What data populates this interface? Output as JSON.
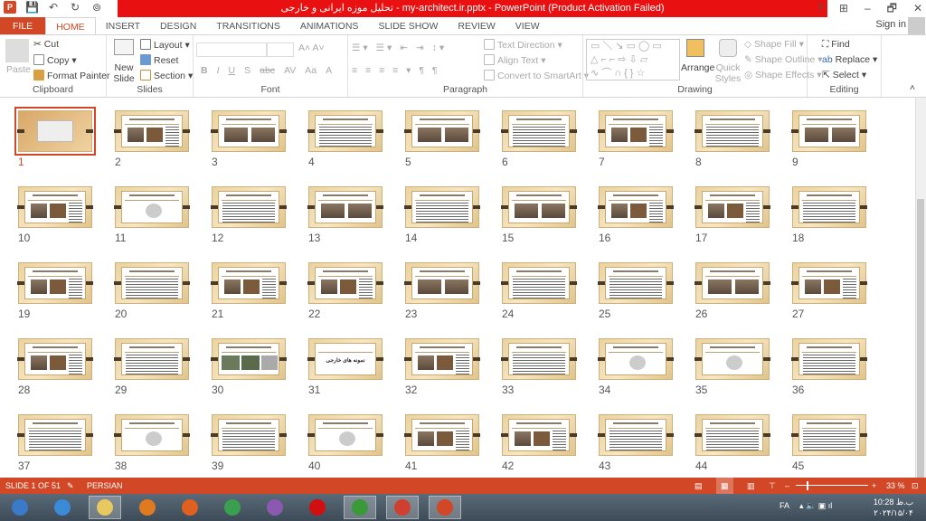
{
  "titlebar": {
    "title": "تحلیل موزه ایرانی و خارجی - my-architect.ir.pptx - PowerPoint (Product Activation Failed)",
    "help": "?",
    "restore_ribbon": "⊞",
    "minimize": "–",
    "maximize": "🗗",
    "close": "✕"
  },
  "tabs": [
    "FILE",
    "HOME",
    "INSERT",
    "DESIGN",
    "TRANSITIONS",
    "ANIMATIONS",
    "SLIDE SHOW",
    "REVIEW",
    "VIEW"
  ],
  "active_tab": "HOME",
  "account": {
    "sign_in": "Sign in"
  },
  "ribbon": {
    "clipboard": {
      "label": "Clipboard",
      "paste": "Paste",
      "cut": "Cut",
      "copy": "Copy",
      "format_painter": "Format Painter"
    },
    "slides": {
      "label": "Slides",
      "new_slide": "New Slide",
      "layout": "Layout",
      "reset": "Reset",
      "section": "Section"
    },
    "font": {
      "label": "Font",
      "font_name": "",
      "font_size": "",
      "bold": "B",
      "italic": "I",
      "underline": "U",
      "shadow": "S",
      "strike": "abc",
      "spacing": "AV",
      "case": "Aa",
      "color": "A"
    },
    "paragraph": {
      "label": "Paragraph",
      "text_direction": "Text Direction",
      "align_text": "Align Text",
      "smartart": "Convert to SmartArt"
    },
    "drawing": {
      "label": "Drawing",
      "arrange": "Arrange",
      "quick_styles": "Quick Styles",
      "shape_fill": "Shape Fill",
      "shape_outline": "Shape Outline",
      "shape_effects": "Shape Effects"
    },
    "editing": {
      "label": "Editing",
      "find": "Find",
      "replace": "Replace",
      "select": "Select"
    }
  },
  "slides": {
    "total": 45,
    "selected": 1,
    "titles": {
      "31": "نمونه های خارجی"
    }
  },
  "status": {
    "slide": "SLIDE 1 OF 51",
    "language": "PERSIAN",
    "zoom": "33 %",
    "zoom_percent": 33
  },
  "taskbar": {
    "apps": [
      "start",
      "internet-explorer",
      "file-explorer",
      "media-player",
      "firefox",
      "chrome",
      "visual-studio",
      "opera",
      "internet-download-manager",
      "chrome-profile",
      "powerpoint"
    ],
    "lang": "FA",
    "time": "10:28 ب.ظ",
    "date": "۲۰۲۴/۱۵/۰۴"
  }
}
